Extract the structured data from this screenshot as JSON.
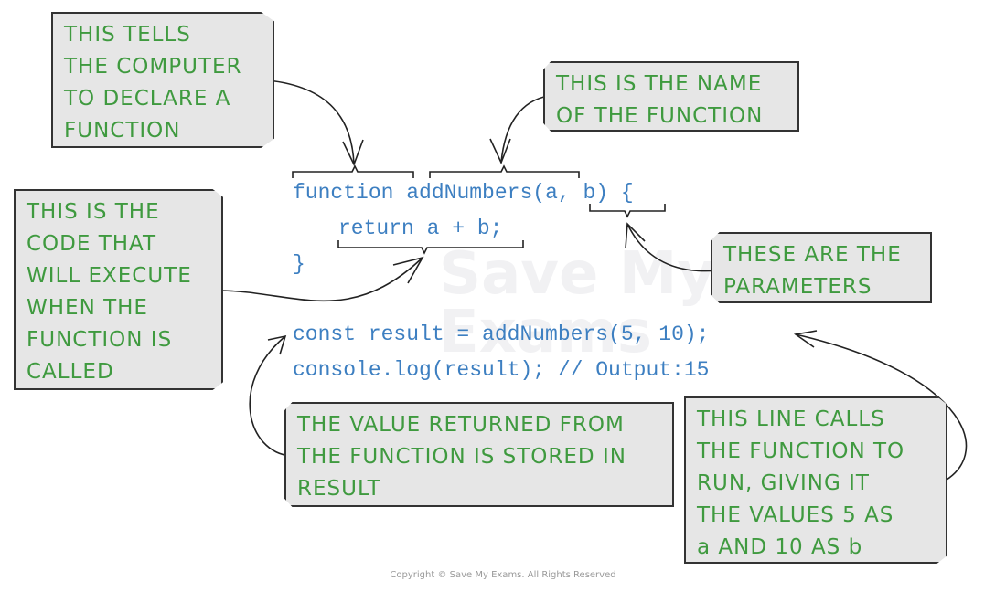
{
  "watermark": "Save My Exams",
  "code": {
    "line1_keyword": "function",
    "line1_name": "addNumbers",
    "line1_params": "(a, b) {",
    "line2": "return a + b;",
    "line3": "}",
    "line4": "const result = addNumbers(5, 10);",
    "line5": "console.log(result); // Output:15"
  },
  "annotations": {
    "declare": [
      "THIS TELLS",
      "THE COMPUTER",
      "TO DECLARE A",
      "FUNCTION"
    ],
    "name": [
      "THIS IS THE NAME",
      "OF THE FUNCTION"
    ],
    "body": [
      "THIS IS THE",
      "CODE THAT",
      "WILL EXECUTE",
      "WHEN THE",
      "FUNCTION IS",
      "CALLED"
    ],
    "params": [
      "THESE ARE THE",
      "PARAMETERS"
    ],
    "result": [
      "THE VALUE RETURNED FROM",
      "THE FUNCTION IS STORED IN",
      "RESULT"
    ],
    "call": [
      "THIS LINE CALLS",
      "THE FUNCTION TO",
      "RUN, GIVING IT",
      "THE VALUES 5 AS",
      "a AND 10 AS b"
    ]
  },
  "copyright": "Copyright © Save My Exams. All Rights Reserved",
  "colors": {
    "annotation_text": "#3f9a3f",
    "code_text": "#3d7fc1",
    "box_fill": "#e6e6e6"
  }
}
